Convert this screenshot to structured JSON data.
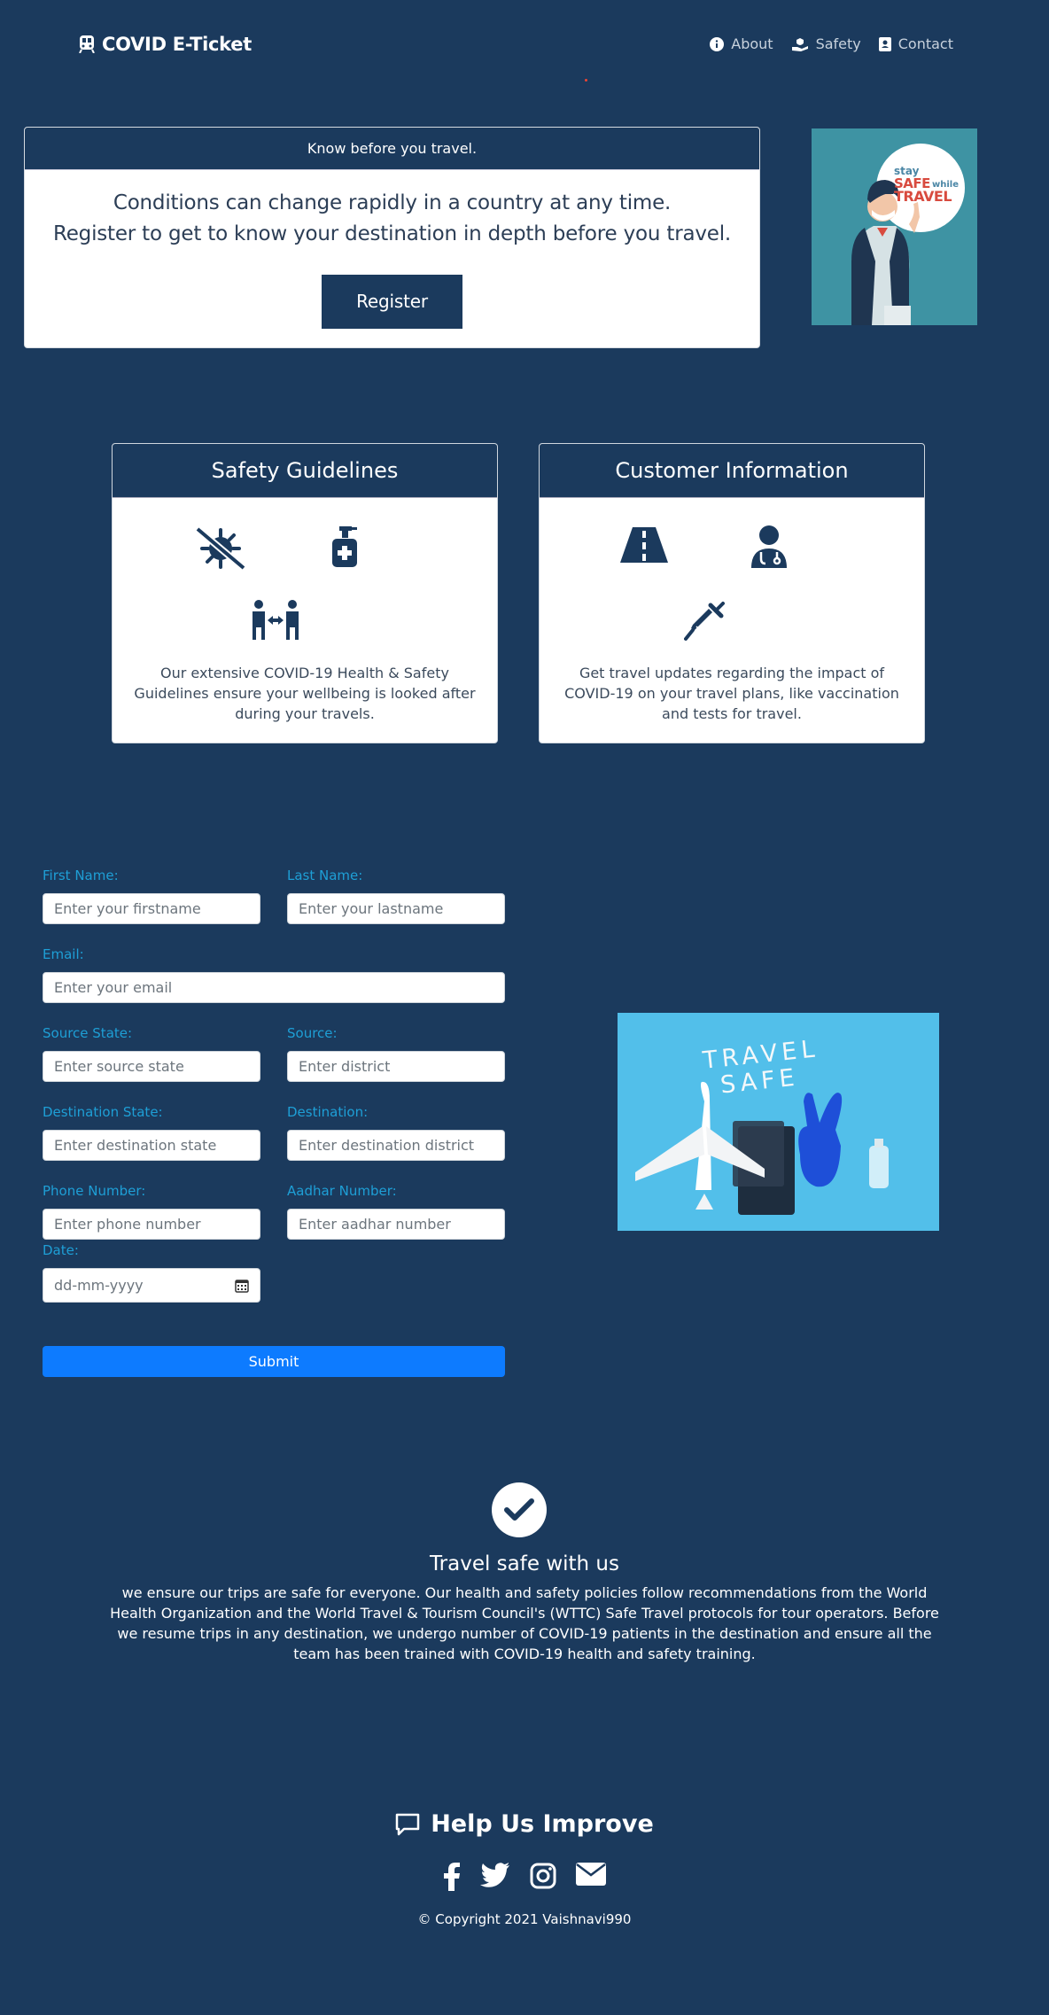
{
  "nav": {
    "brand": "COVID E-Ticket",
    "about": "About",
    "safety": "Safety",
    "contact": "Contact"
  },
  "know": {
    "header": "Know before you travel.",
    "line1": "Conditions can change rapidly in a country at any time.",
    "line2": "Register to get to know your destination in depth before you travel.",
    "register": "Register"
  },
  "poster": {
    "stay": "stay",
    "safe": "SAFE",
    "while": "while",
    "travel": "TRAVEL"
  },
  "cards": {
    "safety": {
      "title": "Safety Guidelines",
      "text": "Our extensive COVID-19 Health & Safety Guidelines ensure your wellbeing is looked after during your travels."
    },
    "customer": {
      "title": "Customer Information",
      "text": "Get travel updates regarding the impact of COVID-19 on your travel plans, like vaccination and tests for travel."
    }
  },
  "form": {
    "first_label": "First Name:",
    "first_ph": "Enter your firstname",
    "last_label": "Last Name:",
    "last_ph": "Enter your lastname",
    "email_label": "Email:",
    "email_ph": "Enter your email",
    "src_state_label": "Source State:",
    "src_state_ph": "Enter source state",
    "src_label": "Source:",
    "src_ph": "Enter district",
    "dst_state_label": "Destination State:",
    "dst_state_ph": "Enter destination state",
    "dst_label": "Destination:",
    "dst_ph": "Enter destination district",
    "phone_label": "Phone Number:",
    "phone_ph": "Enter phone number",
    "aadhar_label": "Aadhar Number:",
    "aadhar_ph": "Enter aadhar number",
    "date_label": "Date:",
    "date_ph": "dd-mm-yyyy",
    "submit": "Submit"
  },
  "safe_image": {
    "line1": "TRAVEL",
    "line2": "SAFE"
  },
  "travel_safe": {
    "title": "Travel safe with us",
    "text": "we ensure our trips are safe for everyone. Our health and safety policies follow recommendations from the World Health Organization and the World Travel & Tourism Council's (WTTC) Safe Travel protocols for tour operators. Before we resume trips in any destination, we undergo number of COVID-19 patients in the destination and ensure all the team has been trained with COVID-19 health and safety training."
  },
  "footer": {
    "help": "Help Us Improve",
    "copyright": "© Copyright 2021 Vaishnavi990"
  },
  "icons": [
    "train-icon",
    "info-icon",
    "safety-hand-icon",
    "contact-card-icon",
    "virus-slash-icon",
    "hand-sanitizer-icon",
    "distancing-icon",
    "road-icon",
    "doctor-icon",
    "syringe-icon",
    "check-icon",
    "comment-icon",
    "facebook-icon",
    "twitter-icon",
    "instagram-icon",
    "envelope-icon",
    "calendar-icon"
  ],
  "colors": {
    "background": "#1b3a5d",
    "label": "#1e9fd6",
    "submit": "#0d7bff"
  }
}
